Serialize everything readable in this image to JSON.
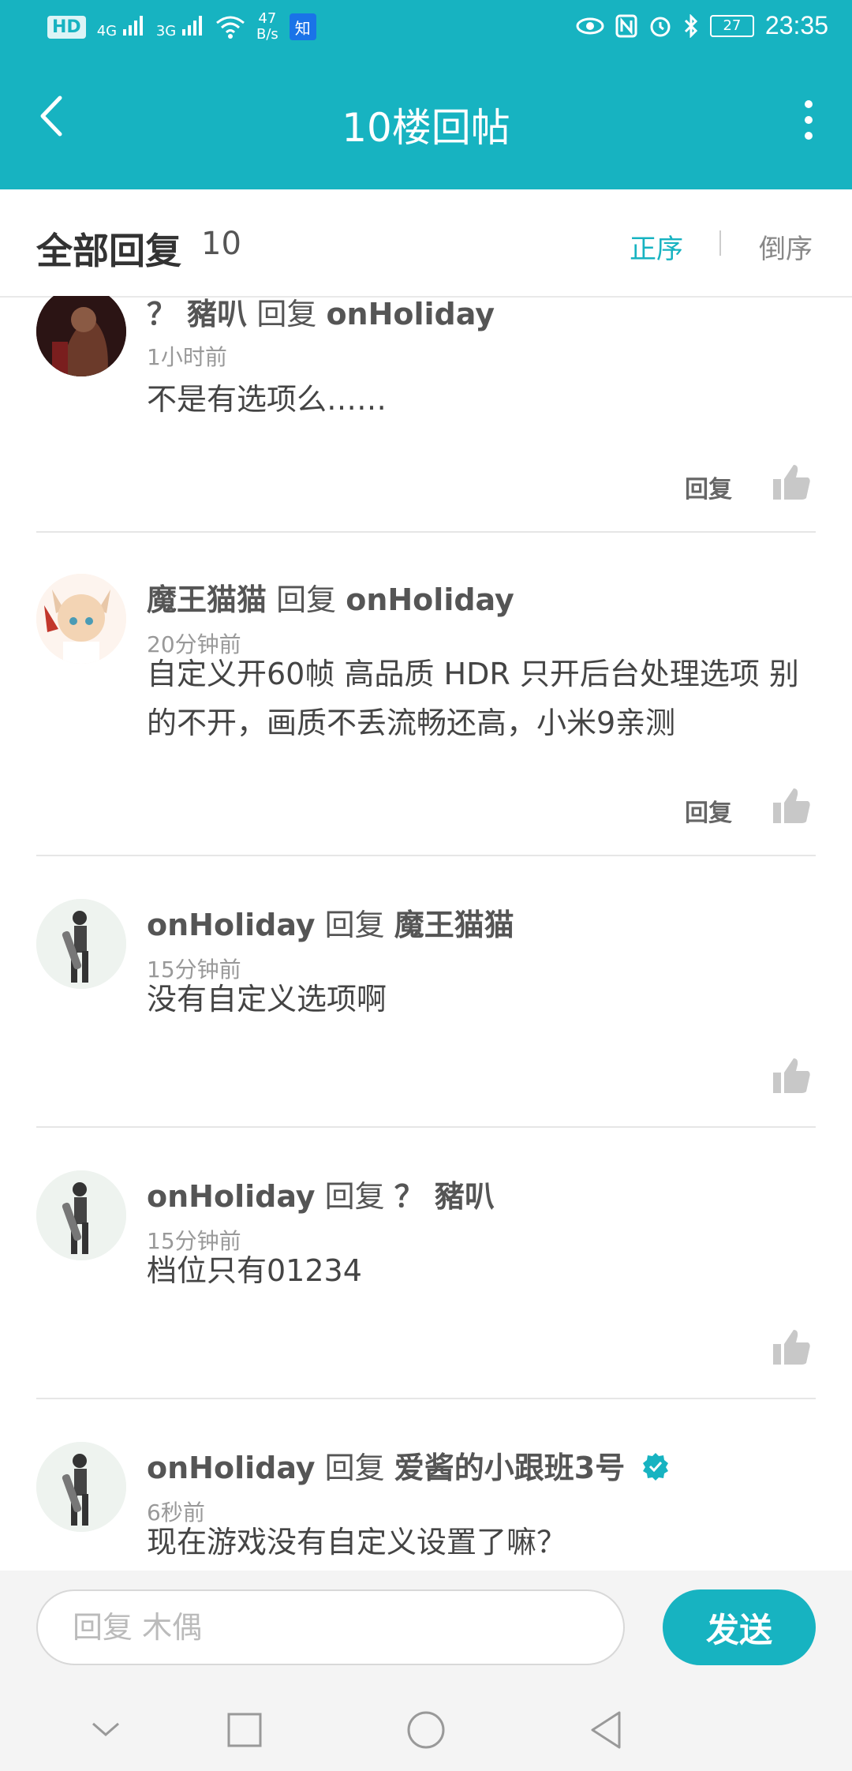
{
  "status_bar": {
    "hd": "HD",
    "net1": "4G",
    "net2": "3G",
    "speed_value": "47",
    "speed_unit": "B/s",
    "zhi": "知",
    "battery": "27",
    "time": "23:35"
  },
  "header": {
    "title": "10楼回帖"
  },
  "sort": {
    "title": "全部回复",
    "count": "10",
    "asc": "正序",
    "desc": "倒序"
  },
  "replies": [
    {
      "user": "？ 豬叭",
      "verb": "回复",
      "target": "onHoliday",
      "time": "1小时前",
      "text": "不是有选项么……",
      "reply_label": "回复"
    },
    {
      "user": "魔王猫猫",
      "verb": "回复",
      "target": "onHoliday",
      "time": "20分钟前",
      "text": "自定义开60帧 高品质 HDR 只开后台处理选项 别的不开，画质不丢流畅还高，小米9亲测",
      "reply_label": "回复"
    },
    {
      "user": "onHoliday",
      "verb": "回复",
      "target": "魔王猫猫",
      "time": "15分钟前",
      "text": "没有自定义选项啊"
    },
    {
      "user": "onHoliday",
      "verb": "回复",
      "target": "？ 豬叭",
      "time": "15分钟前",
      "text": "档位只有01234"
    },
    {
      "user": "onHoliday",
      "verb": "回复",
      "target": "爱酱的小跟班3号",
      "time": "6秒前",
      "text": "现在游戏没有自定义设置了嘛？"
    }
  ],
  "input": {
    "placeholder": "回复 木偶",
    "send_label": "发送"
  },
  "colors": {
    "accent": "#17b3c1"
  }
}
